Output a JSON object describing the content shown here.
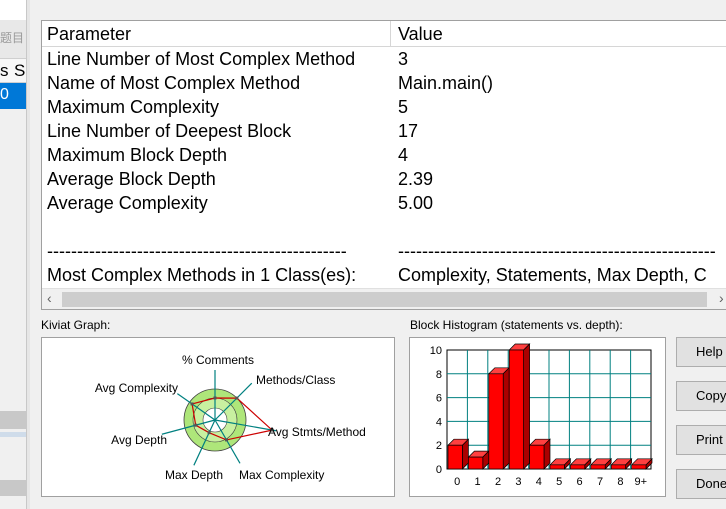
{
  "left_panel": {
    "label_cn": "题目",
    "tabs": [
      "s",
      "S"
    ],
    "selected_row": "0"
  },
  "table": {
    "columns": [
      "Parameter",
      "Value"
    ],
    "rows": [
      {
        "parameter": "Line Number of Most Complex Method",
        "value": "3"
      },
      {
        "parameter": "Name of Most Complex Method",
        "value": "Main.main()"
      },
      {
        "parameter": "Maximum Complexity",
        "value": "5"
      },
      {
        "parameter": "Line Number of Deepest Block",
        "value": "17"
      },
      {
        "parameter": "Maximum Block Depth",
        "value": "4"
      },
      {
        "parameter": "Average Block Depth",
        "value": "2.39"
      },
      {
        "parameter": "Average Complexity",
        "value": "5.00"
      },
      {
        "parameter": "",
        "value": ""
      },
      {
        "parameter": "--------------------------------------------------",
        "value": "-----------------------------------------------------"
      },
      {
        "parameter": "Most Complex Methods in 1 Class(es):",
        "value": "Complexity, Statements, Max Depth, C"
      }
    ]
  },
  "kiviat": {
    "label": "Kiviat Graph:",
    "axes": [
      "% Comments",
      "Methods/Class",
      "Avg Stmts/Method",
      "Max Complexity",
      "Max Depth",
      "Avg Depth",
      "Avg Complexity"
    ],
    "colors": {
      "band": "#aee67a",
      "inner": "#ffffff",
      "poly": "#cc0000",
      "axis": "#008080"
    }
  },
  "histogram": {
    "label": "Block Histogram (statements vs. depth):",
    "y_ticks": [
      "10",
      "8",
      "6",
      "4",
      "2",
      "0"
    ],
    "x_ticks": [
      "0",
      "1",
      "2",
      "3",
      "4",
      "5",
      "6",
      "7",
      "8",
      "9+"
    ]
  },
  "chart_data": {
    "type": "bar",
    "title": "Block Histogram (statements vs. depth):",
    "categories": [
      "0",
      "1",
      "2",
      "3",
      "4",
      "5",
      "6",
      "7",
      "8",
      "9+"
    ],
    "values": [
      2,
      1,
      8,
      10,
      2,
      0,
      0,
      0,
      0,
      0
    ],
    "ylim": [
      0,
      10
    ],
    "bar_color": "#ff0000"
  },
  "buttons": {
    "help": "Help",
    "copy": "Copy",
    "print": "Print",
    "done": "Done"
  }
}
